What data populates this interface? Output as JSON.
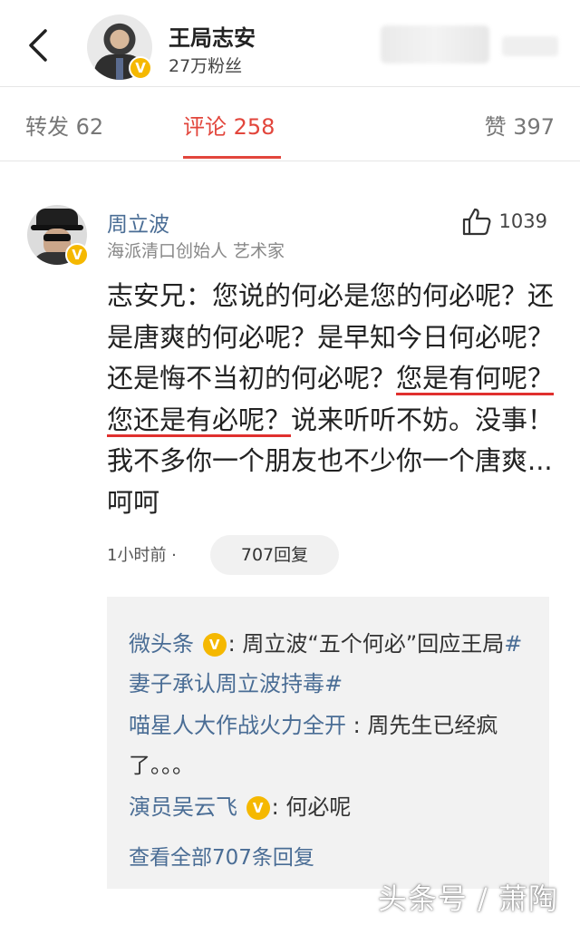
{
  "header": {
    "title": "王局志安",
    "fans": "27万粉丝",
    "verified_mark": "V"
  },
  "tabs": {
    "repost": "转发 62",
    "comment": "评论 258",
    "like": "赞 397",
    "active_color": "#e2463c"
  },
  "comment": {
    "author": "周立波",
    "author_desc": "海派清口创始人 艺术家",
    "likes": "1039",
    "body_before": "志安兄：您说的何必是您的何必呢？还是唐爽的何必呢？是早知今日何必呢？还是悔不当初的何必呢？",
    "body_highlight": "您是有何呢？您还是有必呢？",
    "body_after": "说来听听不妨。没事！我不多你一个朋友也不少你一个唐爽...呵呵",
    "time": "1小时前 ·",
    "reply_count": "707回复"
  },
  "replies": [
    {
      "user": "微头条",
      "verified": true,
      "sep": ": ",
      "text": "周立波“五个何必”回应王局",
      "tag": "#妻子承认周立波持毒#"
    },
    {
      "user": "喵星人大作战火力全开",
      "verified": false,
      "sep": " : ",
      "text": "周先生已经疯了。。。",
      "tag": ""
    },
    {
      "user": "演员吴云飞",
      "verified": true,
      "sep": ": ",
      "text": "何必呢",
      "tag": ""
    }
  ],
  "view_all": "查看全部707条回复",
  "watermark": "头条号 / 萧陶",
  "colors": {
    "link_blue": "#4a6d95",
    "badge_yellow": "#f5b800",
    "underline_red": "#e0302e"
  }
}
